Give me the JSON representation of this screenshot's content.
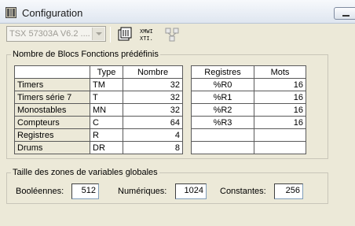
{
  "window": {
    "title": "Configuration"
  },
  "toolbar": {
    "processor_combo": "TSX 57303A  V6.2 ....",
    "button1_icon": "module-icon",
    "button2_label_top": "XMWI",
    "button2_label_bottom": "XTI.",
    "button3_icon": "network-icon"
  },
  "blocs": {
    "legend": "Nombre de Blocs Fonctions prédéfinis",
    "headers": [
      "",
      "Type",
      "Nombre"
    ],
    "rows": [
      {
        "name": "Timers",
        "type": "TM",
        "count": "32"
      },
      {
        "name": "Timers série 7",
        "type": "T",
        "count": "32"
      },
      {
        "name": "Monostables",
        "type": "MN",
        "count": "32"
      },
      {
        "name": "Compteurs",
        "type": "C",
        "count": "64"
      },
      {
        "name": "Registres",
        "type": "R",
        "count": "4"
      },
      {
        "name": "Drums",
        "type": "DR",
        "count": "8"
      }
    ]
  },
  "registres": {
    "headers": [
      "Registres",
      "Mots"
    ],
    "rows": [
      {
        "reg": "%R0",
        "mots": "16"
      },
      {
        "reg": "%R1",
        "mots": "16"
      },
      {
        "reg": "%R2",
        "mots": "16"
      },
      {
        "reg": "%R3",
        "mots": "16"
      },
      {
        "reg": "",
        "mots": ""
      },
      {
        "reg": "",
        "mots": ""
      }
    ]
  },
  "zones": {
    "legend": "Taille des zones de variables globales",
    "booleennes_label": "Booléennes:",
    "booleennes_value": "512",
    "numeriques_label": "Numériques:",
    "numeriques_value": "1024",
    "constantes_label": "Constantes:",
    "constantes_value": "256"
  }
}
